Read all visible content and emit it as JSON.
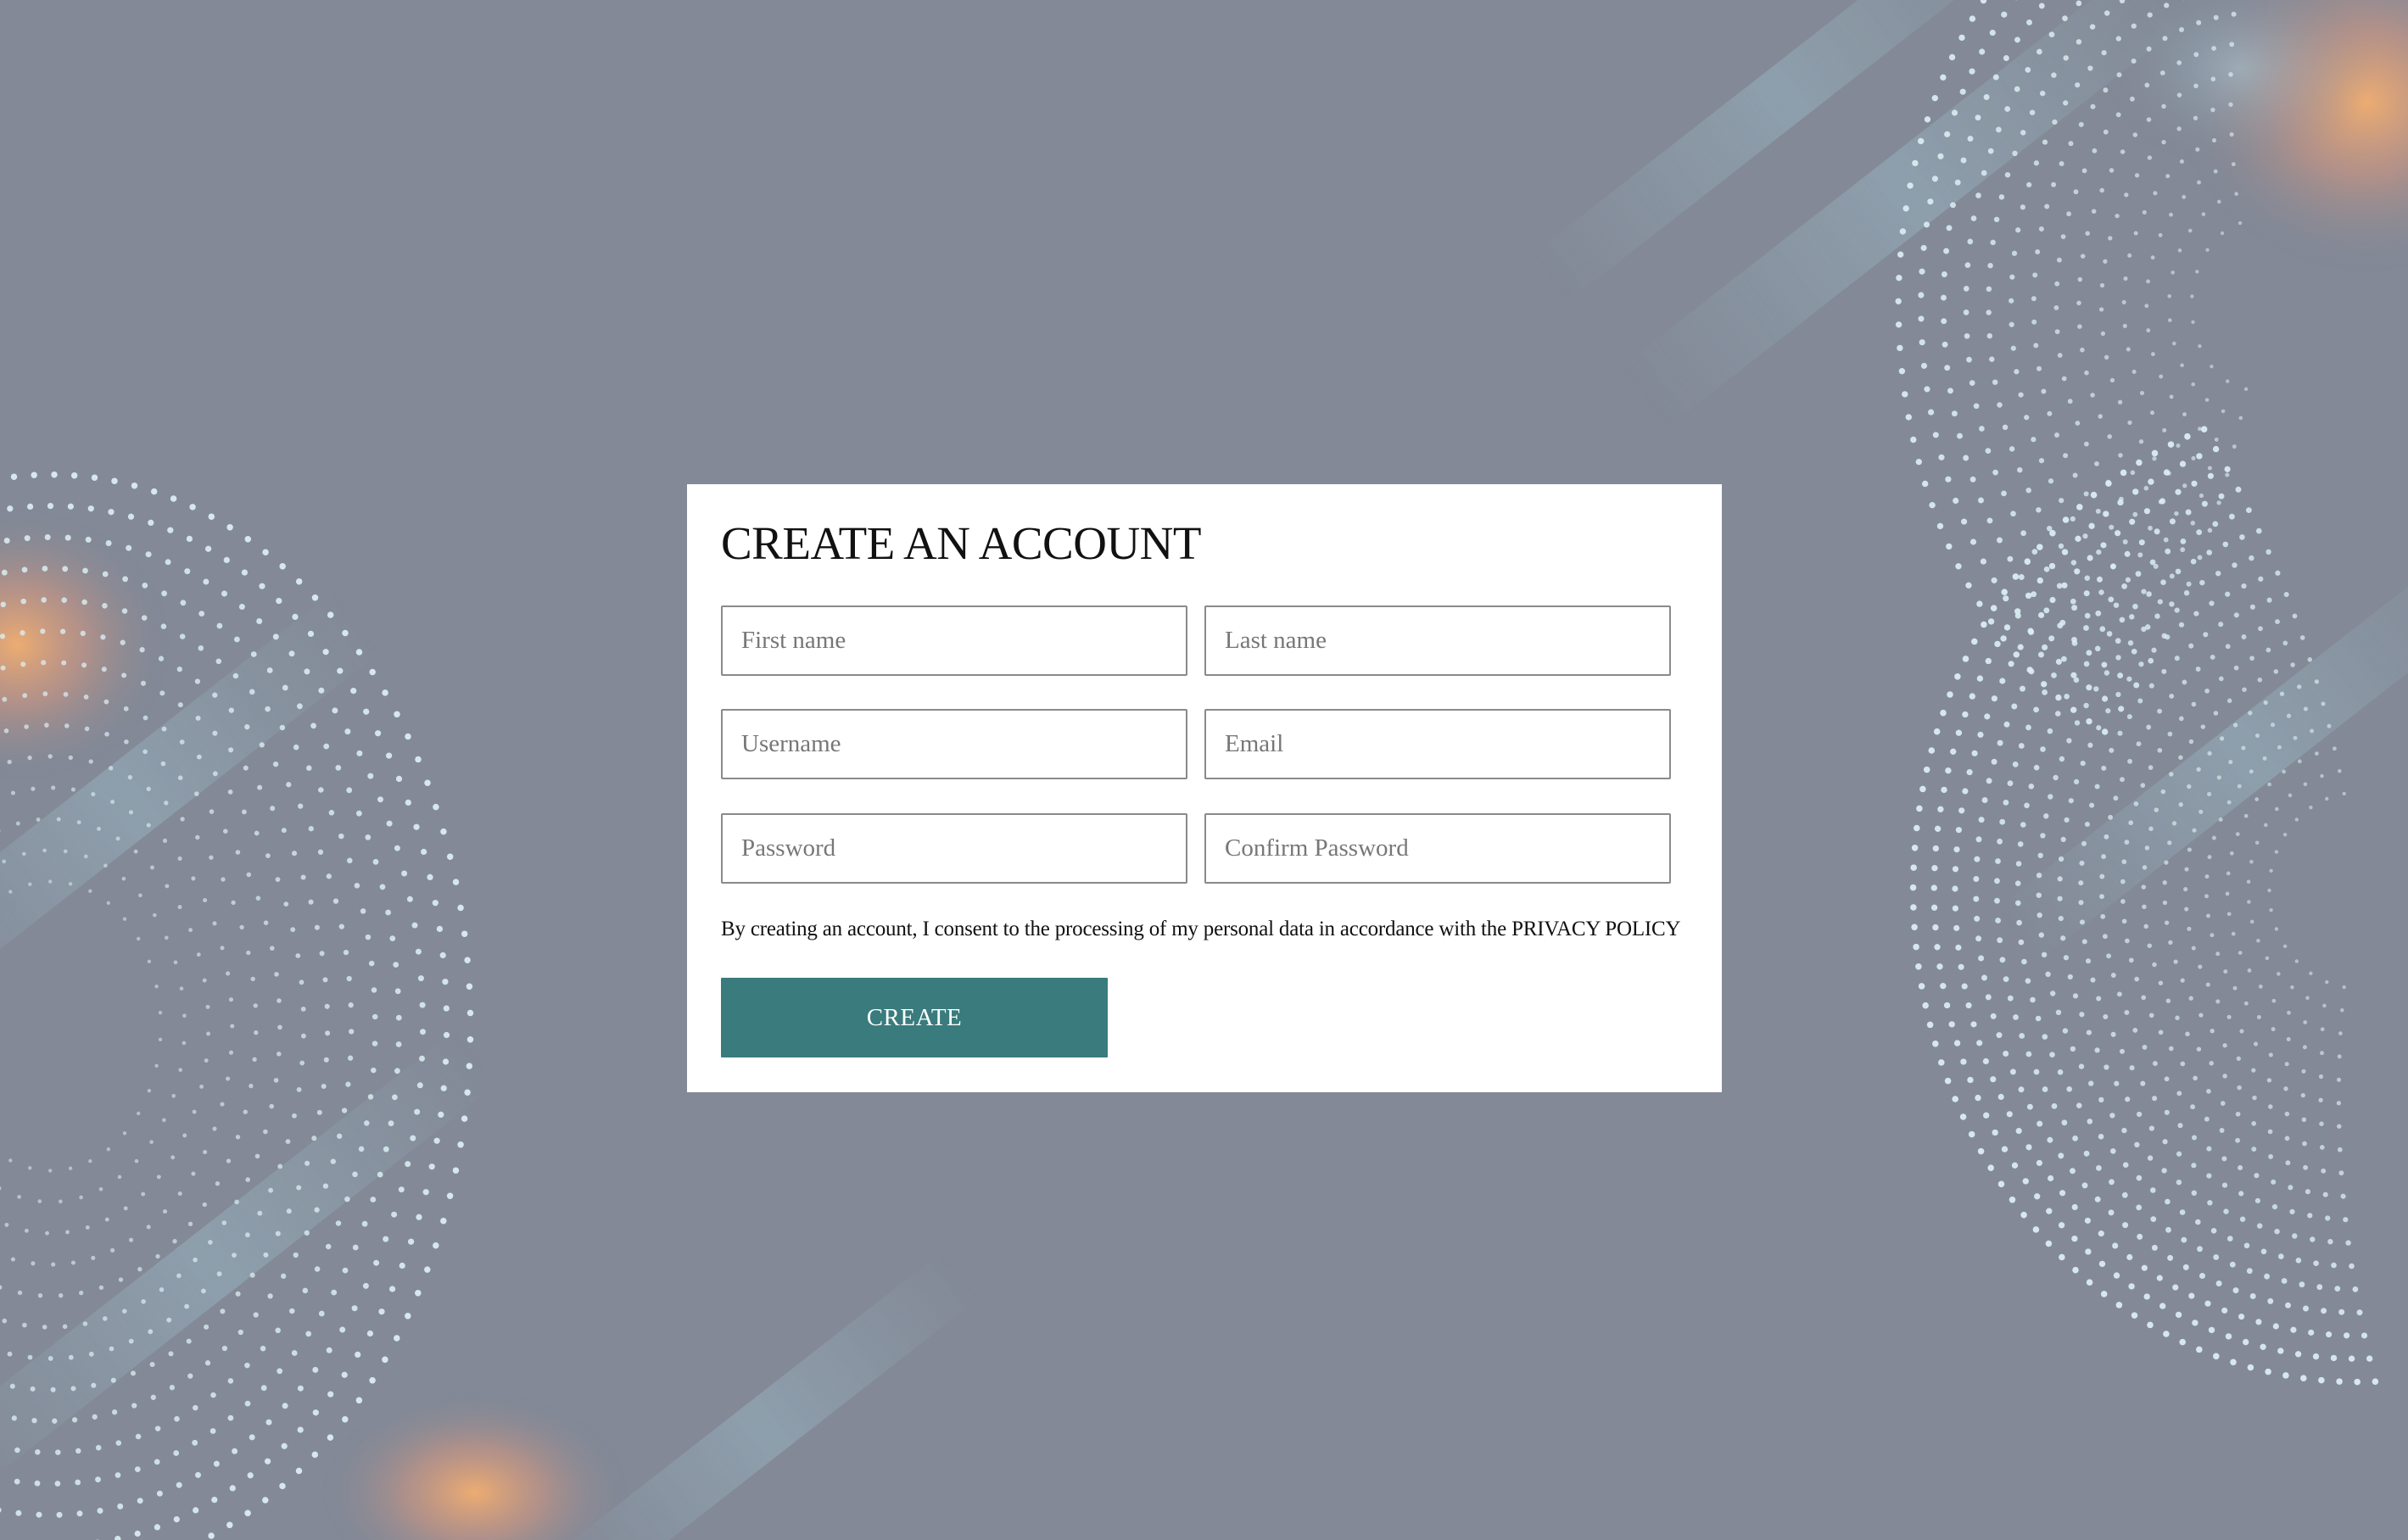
{
  "page": {
    "background_color": "#838997",
    "accent_color": "#3a7b7d"
  },
  "form": {
    "title": "CREATE AN ACCOUNT",
    "fields": {
      "first_name": {
        "placeholder": "First name",
        "value": ""
      },
      "last_name": {
        "placeholder": "Last name",
        "value": ""
      },
      "username": {
        "placeholder": "Username",
        "value": ""
      },
      "email": {
        "placeholder": "Email",
        "value": ""
      },
      "password": {
        "placeholder": "Password",
        "value": ""
      },
      "confirm_password": {
        "placeholder": "Confirm Password",
        "value": ""
      }
    },
    "consent_text": "By creating an account, I consent to the processing of my personal data in accordance with the ",
    "privacy_link": "PRIVACY POLICY",
    "submit_label": "CREATE"
  },
  "background": {
    "decoration": "dotted-sphere-pattern"
  }
}
